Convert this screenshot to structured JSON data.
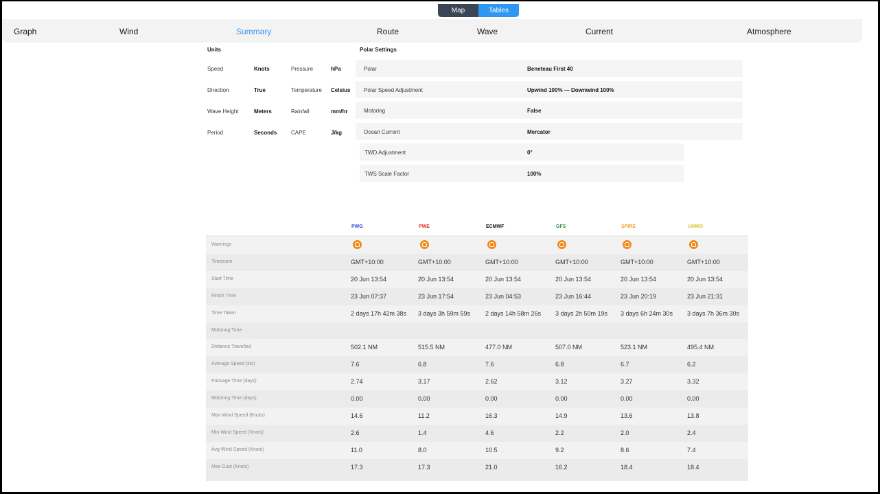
{
  "toggle": {
    "map": "Map",
    "tables": "Tables"
  },
  "tabs": [
    "Graph",
    "Wind",
    "Summary",
    "Route",
    "Wave",
    "Current",
    "Atmosphere"
  ],
  "active_tab": "Summary",
  "units": {
    "title": "Units",
    "rows": [
      [
        "Speed",
        "Knots",
        "Pressure",
        "hPa"
      ],
      [
        "Direction",
        "True",
        "Temperature",
        "Celsius"
      ],
      [
        "Wave Height",
        "Meters",
        "Rainfall",
        "mm/hr"
      ],
      [
        "Period",
        "Seconds",
        "CAPE",
        "J/kg"
      ]
    ]
  },
  "polar": {
    "title": "Polar Settings",
    "rows": [
      [
        "Polar",
        "Beneteau First 40"
      ],
      [
        "Polar Speed Adjustment",
        "Upwind 100% — Downwind 100%"
      ],
      [
        "Motoring",
        "False"
      ],
      [
        "Ocean Current",
        "Mercator"
      ],
      [
        "TWD Adjustment",
        "0°"
      ],
      [
        "TWS Scale Factor",
        "100%"
      ]
    ]
  },
  "models": [
    {
      "name": "PWG",
      "color": "#2f46d6"
    },
    {
      "name": "PWE",
      "color": "#e0302a"
    },
    {
      "name": "ECMWF",
      "color": "#111111"
    },
    {
      "name": "GFS",
      "color": "#2f8a3a"
    },
    {
      "name": "SPIRE",
      "color": "#f0a020"
    },
    {
      "name": "UMMO",
      "color": "#d9c640"
    }
  ],
  "table": {
    "rows": [
      {
        "label": "Warnings",
        "values": [
          "warning-icon",
          "warning-icon",
          "warning-icon",
          "warning-icon",
          "warning-icon",
          "warning-icon"
        ],
        "icon": true
      },
      {
        "label": "Timezone",
        "values": [
          "GMT+10:00",
          "GMT+10:00",
          "GMT+10:00",
          "GMT+10:00",
          "GMT+10:00",
          "GMT+10:00"
        ]
      },
      {
        "label": "Start Time",
        "values": [
          "20 Jun 13:54",
          "20 Jun 13:54",
          "20 Jun 13:54",
          "20 Jun 13:54",
          "20 Jun 13:54",
          "20 Jun 13:54"
        ]
      },
      {
        "label": "Finish Time",
        "values": [
          "23 Jun 07:37",
          "23 Jun 17:54",
          "23 Jun 04:53",
          "23 Jun 16:44",
          "23 Jun 20:19",
          "23 Jun 21:31"
        ]
      },
      {
        "label": "Time Taken",
        "values": [
          "2 days 17h 42m 38s",
          "3 days 3h 59m 59s",
          "2 days 14h 58m 26s",
          "3 days 2h 50m 19s",
          "3 days 6h 24m 30s",
          "3 days 7h 36m 30s"
        ]
      },
      {
        "label": "Motoring Time",
        "values": [
          "",
          "",
          "",
          "",
          "",
          ""
        ]
      },
      {
        "label": "Distance Travelled",
        "values": [
          "502.1 NM",
          "515.5 NM",
          "477.0 NM",
          "507.0 NM",
          "523.1 NM",
          "495.4 NM"
        ]
      },
      {
        "label": "Average Speed (kts)",
        "values": [
          "7.6",
          "6.8",
          "7.6",
          "6.8",
          "6.7",
          "6.2"
        ]
      },
      {
        "label": "Passage Time (days)",
        "values": [
          "2.74",
          "3.17",
          "2.62",
          "3.12",
          "3.27",
          "3.32"
        ]
      },
      {
        "label": "Motoring Time (days)",
        "values": [
          "0.00",
          "0.00",
          "0.00",
          "0.00",
          "0.00",
          "0.00"
        ]
      },
      {
        "label": "Max Wind Speed (Knots)",
        "values": [
          "14.6",
          "11.2",
          "16.3",
          "14.9",
          "13.6",
          "13.8"
        ]
      },
      {
        "label": "Min Wind Speed (Knots)",
        "values": [
          "2.6",
          "1.4",
          "4.6",
          "2.2",
          "2.0",
          "2.4"
        ]
      },
      {
        "label": "Avg Wind Speed (Knots)",
        "values": [
          "11.0",
          "8.0",
          "10.5",
          "9.2",
          "8.6",
          "7.4"
        ]
      },
      {
        "label": "Max Gust (Knots)",
        "values": [
          "17.3",
          "17.3",
          "21.0",
          "16.2",
          "18.4",
          "18.4"
        ]
      }
    ]
  }
}
